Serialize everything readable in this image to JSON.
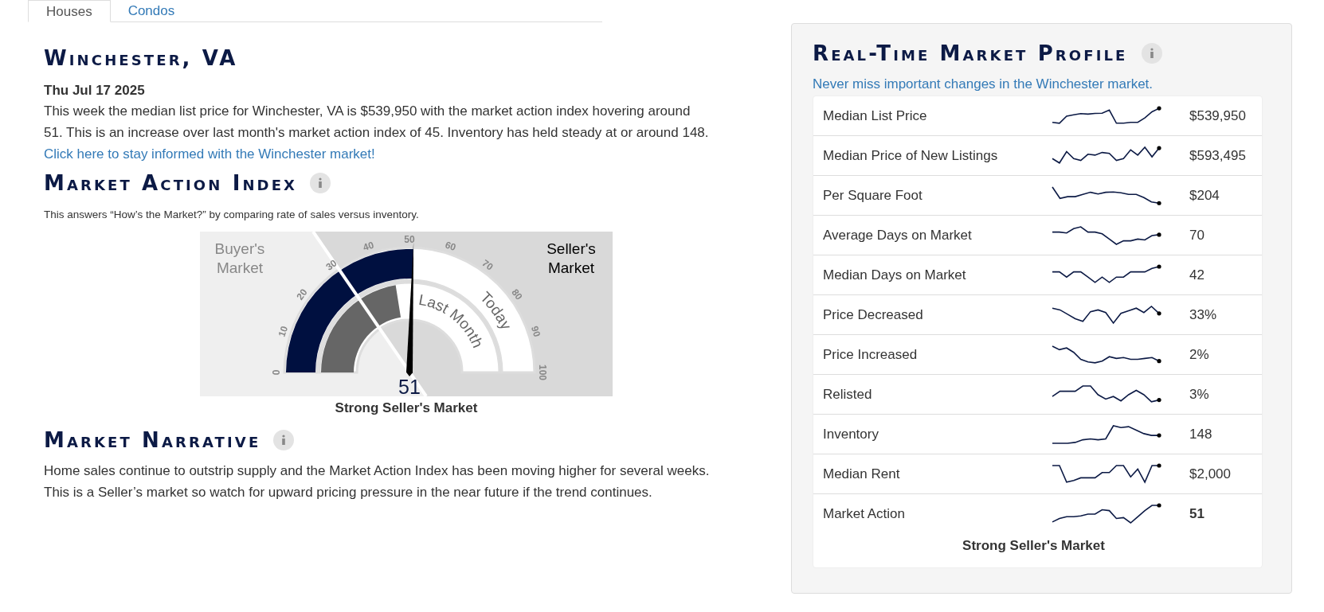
{
  "tabs": [
    {
      "label": "Houses",
      "selected": true
    },
    {
      "label": "Condos",
      "selected": false
    }
  ],
  "location": {
    "title": "Winchester, VA",
    "date": "Thu Jul 17 2025",
    "summary": "This week the median list price for Winchester, VA is $539,950 with the market action index hovering around 51. This is an increase over last month's market action index of 45. Inventory has held steady at or around 148.",
    "link": "Click here to stay informed with the Winchester market!"
  },
  "market_action_index": {
    "title": "Market Action Index",
    "description": "This answers “How’s the Market?” by comparing rate of sales versus inventory.",
    "gauge": {
      "buyers_label": "Buyer's Market",
      "sellers_label": "Seller's Market",
      "ticks": [
        "0",
        "10",
        "20",
        "30",
        "40",
        "50",
        "60",
        "70",
        "80",
        "90",
        "100"
      ],
      "today": {
        "label": "Today",
        "level": 0.51
      },
      "last_month": {
        "label": "Last Month",
        "level": 0.45
      },
      "reading": "51",
      "verdict": "Strong Seller's Market"
    }
  },
  "narrative": {
    "title": "Market Narrative",
    "text": "Home sales continue to outstrip supply and the Market Action Index has been moving higher for several weeks. This is a Seller’s market so watch for upward pricing pressure in the near future if the trend continues."
  },
  "profile": {
    "title": "Real-Time Market Profile",
    "link": "Never miss important changes in the Winchester market.",
    "rows": [
      {
        "label": "Median List Price",
        "value": "$539,950",
        "bold": false
      },
      {
        "label": "Median Price of New Listings",
        "value": "$593,495",
        "bold": false
      },
      {
        "label": "Per Square Foot",
        "value": "$204",
        "bold": false
      },
      {
        "label": "Average Days on Market",
        "value": "70",
        "bold": false
      },
      {
        "label": "Median Days on Market",
        "value": "42",
        "bold": false
      },
      {
        "label": "Price Decreased",
        "value": "33%",
        "bold": false
      },
      {
        "label": "Price Increased",
        "value": "2%",
        "bold": false
      },
      {
        "label": "Relisted",
        "value": "3%",
        "bold": false
      },
      {
        "label": "Inventory",
        "value": "148",
        "bold": false
      },
      {
        "label": "Median Rent",
        "value": "$2,000",
        "bold": false
      },
      {
        "label": "Market Action",
        "value": "51",
        "bold": true
      }
    ],
    "footer": "Strong Seller's Market"
  }
}
